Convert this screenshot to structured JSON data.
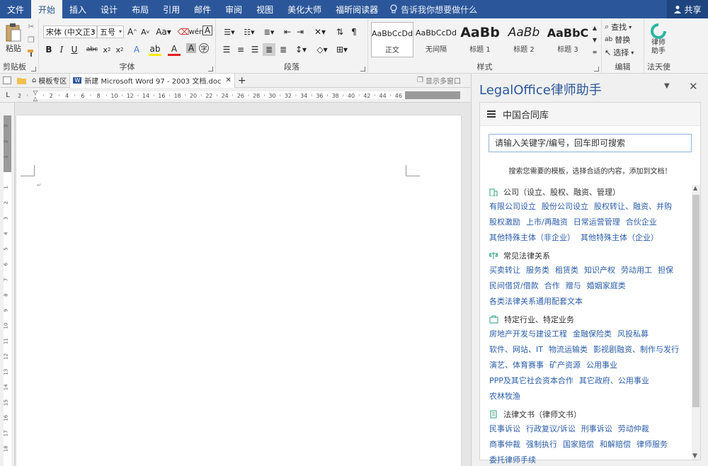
{
  "menubar": {
    "items": [
      "文件",
      "开始",
      "插入",
      "设计",
      "布局",
      "引用",
      "邮件",
      "审阅",
      "视图",
      "美化大师",
      "福昕阅读器"
    ],
    "active_index": 1,
    "tellme": "告诉我你想要做什么",
    "share": "共享"
  },
  "ribbon": {
    "clipboard": {
      "label": "剪贴板",
      "paste": "粘贴"
    },
    "font": {
      "label": "字体",
      "font_name": "宋体 (中文正3",
      "font_size": "五号"
    },
    "paragraph": {
      "label": "段落"
    },
    "styles": {
      "label": "样式",
      "items": [
        {
          "sample": "AaBbCcDd",
          "name": "正文"
        },
        {
          "sample": "AaBbCcDd",
          "name": "无间隔"
        },
        {
          "sample": "AaBb",
          "name": "标题 1"
        },
        {
          "sample": "AaBb",
          "name": "标题 2"
        },
        {
          "sample": "AaBbC",
          "name": "标题 3"
        }
      ]
    },
    "editing": {
      "label": "编辑",
      "find": "查找",
      "replace": "替换",
      "select": "选择"
    },
    "lawyer": {
      "label": "法天使",
      "button": "律师助手"
    }
  },
  "doc_tabs": {
    "template_tab": "模板专区",
    "doc_tab": "新建 Microsoft Word 97 - 2003 文档.doc",
    "multi_window": "显示多窗口"
  },
  "ruler": {
    "h_labels": [
      "8",
      "6",
      "4",
      "2",
      "2",
      "4",
      "6",
      "8",
      "10",
      "12",
      "14",
      "16",
      "18",
      "20",
      "22",
      "24",
      "26",
      "28",
      "30",
      "32",
      "34",
      "36",
      "38",
      "40",
      "42",
      "44",
      "46"
    ],
    "v_labels": [
      "4",
      "3",
      "2",
      "1",
      "1",
      "2",
      "3",
      "4",
      "5",
      "6",
      "7",
      "8",
      "9",
      "10",
      "11",
      "12",
      "13",
      "14",
      "15",
      "16",
      "17",
      "18",
      "19"
    ]
  },
  "panel": {
    "title": "LegalOffice律师助手",
    "library_title": "中国合同库",
    "search_placeholder": "请输入关键字/编号，回车即可搜索",
    "hint": "搜索您需要的模板，选择合适的内容，添加到文档！",
    "categories": [
      {
        "icon": "building-icon",
        "title": "公司（设立、股权、融资、管理）",
        "items": [
          "有限公司设立",
          "股份公司设立",
          "股权转让、融资、并购",
          "股权激励",
          "上市/再融资",
          "日常运营管理",
          "合伙企业",
          "其他特殊主体（非企业）",
          "其他特殊主体（企业）"
        ]
      },
      {
        "icon": "scales-icon",
        "title": "常见法律关系",
        "items": [
          "买卖转让",
          "服务类",
          "租赁类",
          "知识产权",
          "劳动用工",
          "担保",
          "民间借贷/借款",
          "合作",
          "赠与",
          "婚姻家庭类",
          "各类法律关系通用配套文本"
        ]
      },
      {
        "icon": "briefcase-icon",
        "title": "特定行业、特定业务",
        "items": [
          "房地产开发与建设工程",
          "金融保险类",
          "风投私募",
          "软件、网站、IT",
          "物流运输类",
          "影视剧融资、制作与发行",
          "演艺、体育赛事",
          "矿产资源",
          "公用事业",
          "PPP及其它社会资本合作",
          "其它政府、公用事业",
          "农林牧渔"
        ]
      },
      {
        "icon": "document-icon",
        "title": "法律文书（律师文书）",
        "items": [
          "民事诉讼",
          "行政复议/诉讼",
          "刑事诉讼",
          "劳动仲裁",
          "商事仲裁",
          "强制执行",
          "国家赔偿",
          "和解赔偿",
          "律师服务",
          "委托律师手续"
        ]
      }
    ]
  },
  "colors": {
    "accent": "#2b579a",
    "link": "#2b5ea8"
  }
}
